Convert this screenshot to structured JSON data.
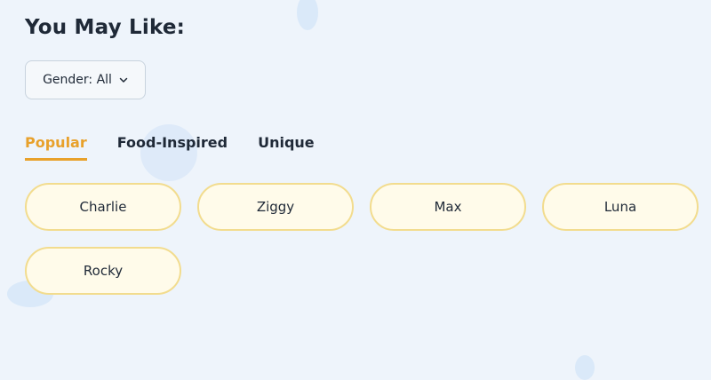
{
  "section": {
    "title": "You May Like:"
  },
  "filter": {
    "gender_label": "Gender: All"
  },
  "tabs": [
    {
      "label": "Popular",
      "active": true
    },
    {
      "label": "Food-Inspired",
      "active": false
    },
    {
      "label": "Unique",
      "active": false
    }
  ],
  "names": [
    "Charlie",
    "Ziggy",
    "Max",
    "Luna",
    "Rocky"
  ],
  "colors": {
    "background": "#eef4fb",
    "accent": "#e8a12b",
    "chip_fill": "#fffbea",
    "chip_border": "#f2dc8e"
  },
  "icons": {
    "dropdown": "chevron-down-icon"
  }
}
